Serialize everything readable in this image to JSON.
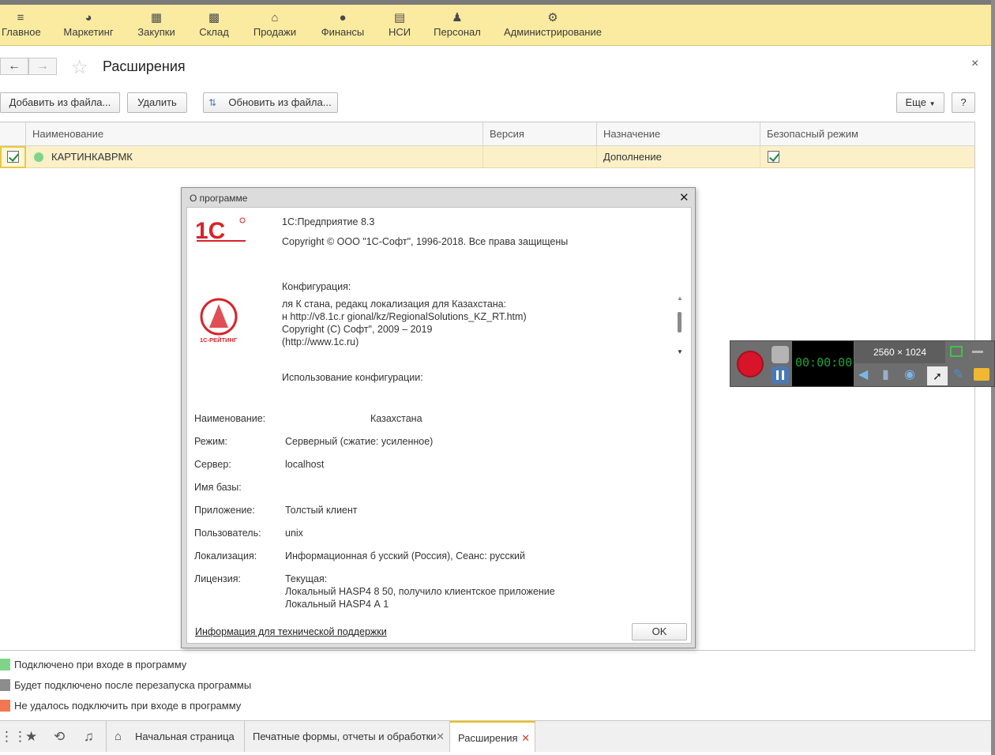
{
  "topmenu": {
    "items": [
      {
        "label": "Главное",
        "icon": "menu-lines-icon"
      },
      {
        "label": "Маркетинг",
        "icon": "pie-chart-icon"
      },
      {
        "label": "Закупки",
        "icon": "cart-icon"
      },
      {
        "label": "Склад",
        "icon": "warehouse-icon"
      },
      {
        "label": "Продажи",
        "icon": "basket-icon"
      },
      {
        "label": "Финансы",
        "icon": "coin-icon"
      },
      {
        "label": "НСИ",
        "icon": "documents-icon"
      },
      {
        "label": "Персонал",
        "icon": "person-icon"
      },
      {
        "label": "Администрирование",
        "icon": "gear-icon"
      }
    ]
  },
  "page": {
    "title": "Расширения",
    "close": "×"
  },
  "toolbar": {
    "add_from_file": "Добавить из файла...",
    "delete": "Удалить",
    "update_from_file": "Обновить из файла...",
    "more": "Еще",
    "help": "?"
  },
  "table": {
    "columns": [
      "Наименование",
      "Версия",
      "Назначение",
      "Безопасный режим"
    ],
    "rows": [
      {
        "active": true,
        "name": "КАРТИНКАВРМК",
        "version": "",
        "purpose": "Дополнение",
        "safe_mode": true,
        "status_color": "#7ed58a"
      }
    ]
  },
  "legend": [
    {
      "color": "#7ed58a",
      "text": "Подключено при входе в программу"
    },
    {
      "color": "#8c8c8c",
      "text": "Будет подключено после перезапуска программы"
    },
    {
      "color": "#f07850",
      "text": "Не удалось подключить при входе в программу"
    }
  ],
  "bottombar": {
    "tabs": [
      {
        "label": "Начальная страница"
      },
      {
        "label": "Печатные формы, отчеты и обработки",
        "close": "✕"
      },
      {
        "label": "Расширения",
        "close": "✕"
      }
    ]
  },
  "dialog": {
    "title": "О программе",
    "close": "✕",
    "product": "1С:Предприятие 8.3",
    "copyright": "Copyright © ООО \"1С-Софт\", 1996-2018. Все права защищены",
    "config_header": "Конфигурация:",
    "config_lines": [
      "ля К    стана, редакц       локализация для Казахстана:",
      "н           http://v8.1c.r    gional/kz/RegionalSolutions_KZ_RT.htm)",
      "Copyright (C)            Софт\", 2009 – 2019",
      "(http://www.1c.ru)"
    ],
    "usage_header": "Использование конфигурации:",
    "fields": [
      {
        "label": "Наименование:",
        "value": "Казахстана"
      },
      {
        "label": "Режим:",
        "value": "Серверный (сжатие: усиленное)"
      },
      {
        "label": "Сервер:",
        "value": "localhost"
      },
      {
        "label": "Имя базы:",
        "value": ""
      },
      {
        "label": "Приложение:",
        "value": "Толстый клиент"
      },
      {
        "label": "Пользователь:",
        "value": "unix"
      },
      {
        "label": "Локализация:",
        "value": "Информационная б         усский (Россия), Сеанс: русский"
      },
      {
        "label": "Лицензия:",
        "value": "Текущая:"
      }
    ],
    "license_lines": [
      "Локальный HASP4           8 50, получило клиентское приложение",
      "Локальный HASP4           А 1"
    ],
    "support_link": "Информация для технической поддержки",
    "ok": "OK",
    "logo_text": "1С",
    "rating_text": "1С-РЕЙТИНГ"
  },
  "recorder": {
    "resolution": "2560 × 1024",
    "timer": "00:00:00"
  }
}
